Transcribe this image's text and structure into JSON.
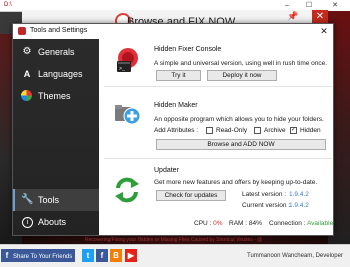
{
  "background": {
    "title": "D:\\",
    "banner_label": "Browse and FIX NOW",
    "ticker_text": "Recovering/Fixing your Hidden or Missing Files Caused by Shortcut Viruses - @",
    "share_label": "Share To Your Friends",
    "developer_credit": "Tummanoon Wancheam, Developer",
    "social_icons": [
      "facebook-icon",
      "twitter-icon",
      "facebook-icon",
      "blogger-icon",
      "youtube-icon"
    ]
  },
  "dialog": {
    "title": "Tools and Settings",
    "close_glyph": "✕",
    "sidebar": {
      "items": [
        {
          "label": "Generals",
          "icon": "gear-icon",
          "active": false
        },
        {
          "label": "Languages",
          "icon": "font-icon",
          "active": false
        },
        {
          "label": "Themes",
          "icon": "palette-icon",
          "active": false
        },
        {
          "label": "Tools",
          "icon": "wrench-icon",
          "active": true
        },
        {
          "label": "Abouts",
          "icon": "info-icon",
          "active": false
        }
      ]
    },
    "hidden_fixer": {
      "title": "Hidden Fixer Console",
      "description": "A simple and universal version, using well in rush time once.",
      "try_label": "Try it",
      "deploy_label": "Deploy it now"
    },
    "hidden_maker": {
      "title": "Hidden Maker",
      "description": "An opposite program which allows you to hide your folders.",
      "add_attributes_label": "Add Attributes :",
      "attributes": [
        {
          "label": "Read-Only",
          "checked": false
        },
        {
          "label": "Archive",
          "checked": false
        },
        {
          "label": "Hidden",
          "checked": true
        }
      ],
      "browse_label": "Browse and ADD NOW"
    },
    "updater": {
      "title": "Updater",
      "description": "Get more new features and offers by keeping up-to-date.",
      "check_label": "Check for updates",
      "latest_label": "Latest version :",
      "latest_value": "1.9.4.2",
      "current_label": "Current version :",
      "current_value": "1.9.4.2"
    },
    "status": {
      "cpu_label": "CPU :",
      "cpu_value": "0%",
      "ram_label": "RAM :",
      "ram_value": "84%",
      "connection_label": "Connection :",
      "connection_value": "Available"
    }
  },
  "colors": {
    "accent_red": "#c0282d",
    "value_blue": "#3a7bd5",
    "cpu_red": "#d32f2f",
    "connection_green": "#2e9e3a"
  }
}
